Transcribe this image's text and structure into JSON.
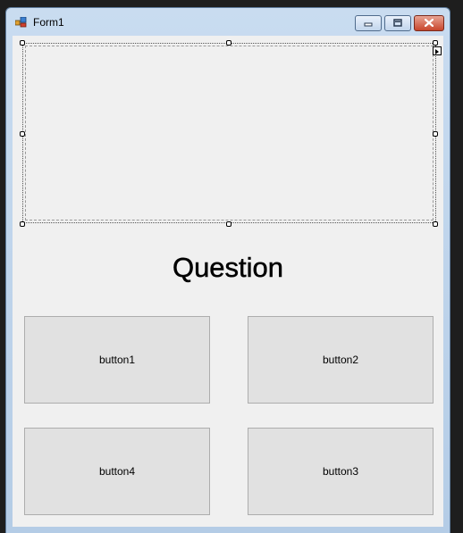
{
  "window": {
    "title": "Form1"
  },
  "form": {
    "question_label": "Question",
    "buttons": {
      "button1": "button1",
      "button2": "button2",
      "button3": "button3",
      "button4": "button4"
    }
  },
  "colors": {
    "client_background": "#f0f0f0",
    "button_background": "#e1e1e1",
    "close_button": "#c8462c",
    "title_bar": "#c9dcf0"
  },
  "icons": [
    "app-icon",
    "minimize-icon",
    "maximize-icon",
    "close-icon",
    "smart-tag-arrow-icon"
  ]
}
